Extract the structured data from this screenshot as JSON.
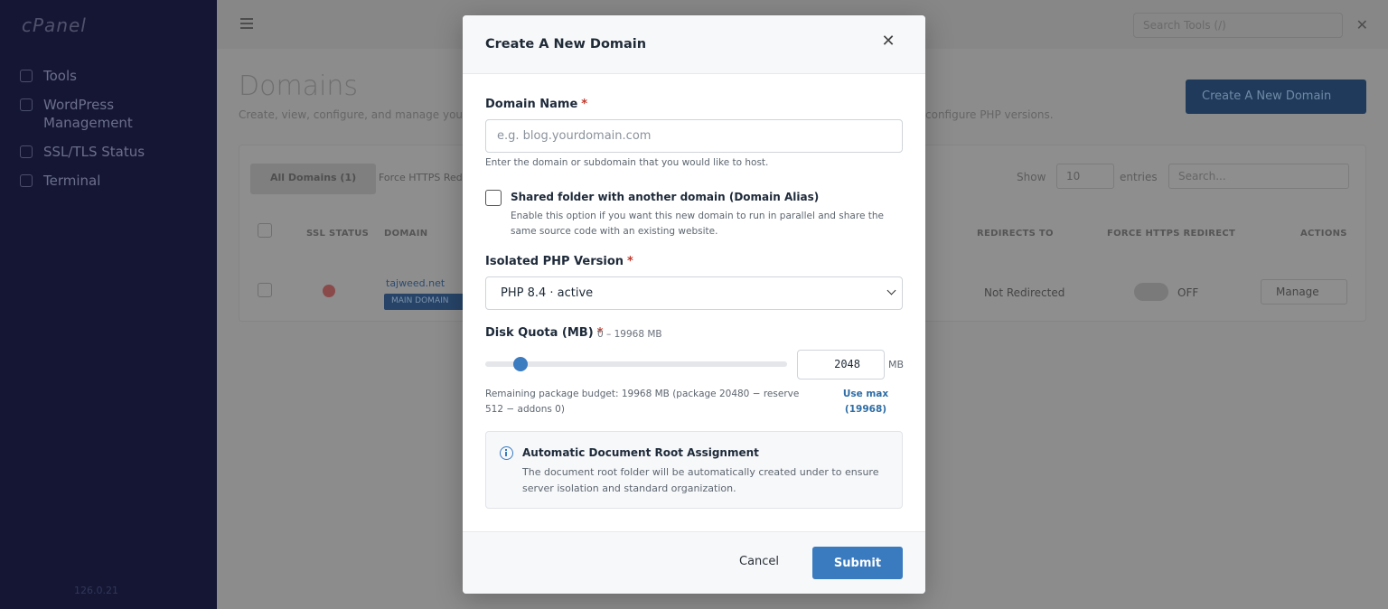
{
  "sidebar": {
    "logo": "cPanel",
    "items": [
      {
        "label": "Tools"
      },
      {
        "label": "WordPress Management"
      },
      {
        "label": "SSL/TLS Status"
      },
      {
        "label": "Terminal"
      }
    ],
    "version": "126.0.21"
  },
  "topbar": {
    "search_placeholder": "Search Tools (/)"
  },
  "page": {
    "title": "Domains",
    "subtitle": "Create, view, configure, and manage your domains.",
    "subtitle_tail": "configure PHP versions.",
    "create_button": "Create A New Domain",
    "tabs": [
      "All Domains (1)",
      "Force HTTPS Redirect"
    ],
    "show_label": "Show",
    "show_value": "10",
    "entries_label": "entries",
    "search_placeholder": "Search...",
    "columns": [
      "SSL STATUS",
      "DOMAIN",
      "REDIRECTS TO",
      "FORCE HTTPS REDIRECT",
      "ACTIONS"
    ],
    "row": {
      "domain": "tajweed.net",
      "badge": "MAIN DOMAIN",
      "redirects": "Not Redirected",
      "https": "OFF",
      "action": "Manage"
    }
  },
  "modal": {
    "title": "Create A New Domain",
    "domain_label": "Domain Name",
    "domain_placeholder": "e.g. blog.yourdomain.com",
    "domain_help": "Enter the domain or subdomain that you would like to host.",
    "alias_label": "Shared folder with another domain (Domain Alias)",
    "alias_help": "Enable this option if you want this new domain to run in parallel and share the same source code with an existing website.",
    "php_label": "Isolated PHP Version",
    "php_value": "PHP 8.4 · active",
    "quota_label": "Disk Quota (MB)",
    "quota_range": "0 – 19968 MB",
    "quota_value": "2048",
    "quota_max": 19968,
    "quota_unit": "MB",
    "budget_text": "Remaining package budget: 19968 MB (package 20480 − reserve 512 − addons 0)",
    "use_max": "Use max (19968)",
    "info_title": "Automatic Document Root Assignment",
    "info_text": "The document root folder will be automatically created under to ensure server isolation and standard organization.",
    "cancel": "Cancel",
    "submit": "Submit",
    "required_mark": "*"
  },
  "colors": {
    "accent": "#3a7bbf",
    "sidebar": "#141634",
    "required": "#c0392b"
  }
}
